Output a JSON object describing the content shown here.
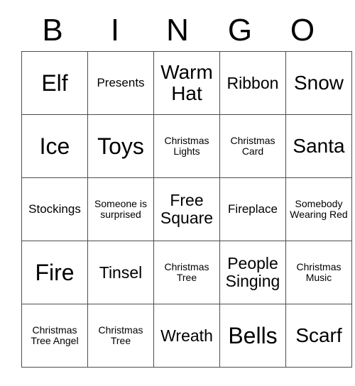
{
  "card": {
    "headers": [
      "B",
      "I",
      "N",
      "G",
      "O"
    ],
    "rows": [
      [
        {
          "text": "Elf",
          "size": "fs-xl"
        },
        {
          "text": "Presents",
          "size": "fs-sm"
        },
        {
          "text": "Warm Hat",
          "size": "fs-lg"
        },
        {
          "text": "Ribbon",
          "size": "fs-md"
        },
        {
          "text": "Snow",
          "size": "fs-lg"
        }
      ],
      [
        {
          "text": "Ice",
          "size": "fs-xl"
        },
        {
          "text": "Toys",
          "size": "fs-xl"
        },
        {
          "text": "Christmas Lights",
          "size": "fs-xs"
        },
        {
          "text": "Christmas Card",
          "size": "fs-xs"
        },
        {
          "text": "Santa",
          "size": "fs-lg"
        }
      ],
      [
        {
          "text": "Stockings",
          "size": "fs-sm"
        },
        {
          "text": "Someone is surprised",
          "size": "fs-xs"
        },
        {
          "text": "Free Square",
          "size": "fs-md"
        },
        {
          "text": "Fireplace",
          "size": "fs-sm"
        },
        {
          "text": "Somebody Wearing Red",
          "size": "fs-xs"
        }
      ],
      [
        {
          "text": "Fire",
          "size": "fs-xl"
        },
        {
          "text": "Tinsel",
          "size": "fs-md"
        },
        {
          "text": "Christmas Tree",
          "size": "fs-xs"
        },
        {
          "text": "People Singing",
          "size": "fs-md"
        },
        {
          "text": "Christmas Music",
          "size": "fs-xs"
        }
      ],
      [
        {
          "text": "Christmas Tree Angel",
          "size": "fs-xs"
        },
        {
          "text": "Christmas Tree",
          "size": "fs-xs"
        },
        {
          "text": "Wreath",
          "size": "fs-md"
        },
        {
          "text": "Bells",
          "size": "fs-xl"
        },
        {
          "text": "Scarf",
          "size": "fs-lg"
        }
      ]
    ]
  }
}
